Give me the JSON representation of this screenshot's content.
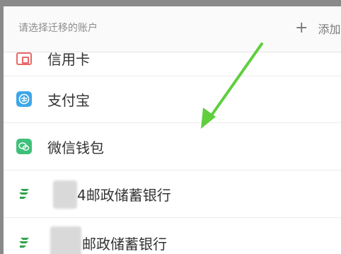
{
  "header": {
    "title": "请选择迁移的账户",
    "add_label": "添加",
    "add_icon": "plus-icon"
  },
  "accounts": [
    {
      "label": "信用卡",
      "icon": "credit-card-icon",
      "color": "#e86a6a"
    },
    {
      "label": "支付宝",
      "icon": "alipay-icon",
      "color": "#3ea6e8"
    },
    {
      "label": "微信钱包",
      "icon": "wechat-wallet-icon",
      "color": "#3fc07a"
    },
    {
      "label_suffix": "4邮政储蓄银行",
      "icon": "postal-bank-icon",
      "color": "#2fa24a"
    },
    {
      "label_suffix": "邮政储蓄银行",
      "icon": "postal-bank-icon",
      "color": "#2fa24a"
    }
  ],
  "annotation": {
    "color": "#5fcf3e"
  }
}
